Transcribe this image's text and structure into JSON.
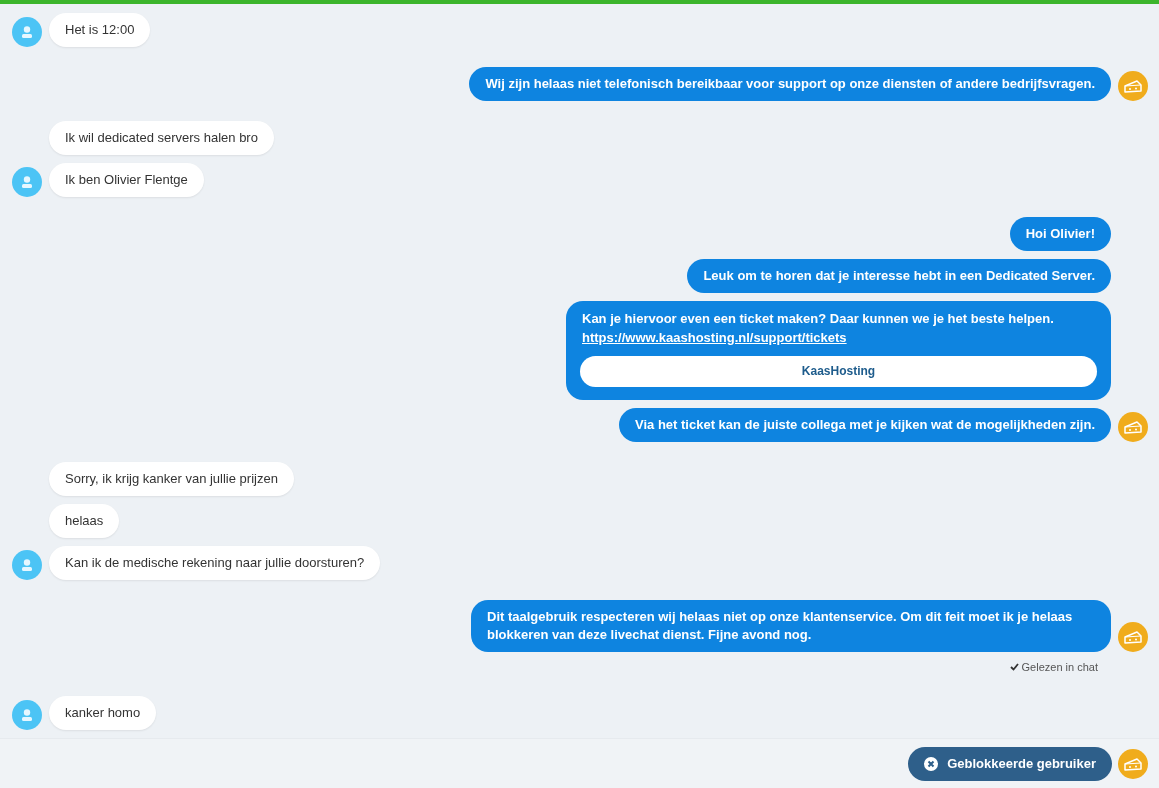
{
  "groups": [
    {
      "kind": "visitor",
      "messages": [
        {
          "kind": "text",
          "text": "Het is 12:00"
        }
      ]
    },
    {
      "kind": "agent",
      "messages": [
        {
          "kind": "text",
          "text": "Wij zijn helaas niet telefonisch bereikbaar voor support op onze diensten of andere bedrijfsvragen."
        }
      ]
    },
    {
      "kind": "visitor",
      "messages": [
        {
          "kind": "text",
          "text": "Ik wil dedicated servers halen bro"
        },
        {
          "kind": "text",
          "text": "Ik ben Olivier Flentge"
        }
      ]
    },
    {
      "kind": "agent",
      "messages": [
        {
          "kind": "text",
          "text": "Hoi Olivier!"
        },
        {
          "kind": "text",
          "text": "Leuk om te horen dat je interesse hebt in een Dedicated Server."
        },
        {
          "kind": "card",
          "text": "Kan je hiervoor even een ticket maken? Daar kunnen we je het beste helpen.",
          "link": "https://www.kaashosting.nl/support/tickets",
          "button": "KaasHosting"
        },
        {
          "kind": "text",
          "text": "Via het ticket kan de juiste collega met je kijken wat de mogelijkheden zijn."
        }
      ]
    },
    {
      "kind": "visitor",
      "messages": [
        {
          "kind": "text",
          "text": "Sorry, ik krijg kanker van jullie prijzen"
        },
        {
          "kind": "text",
          "text": "helaas"
        },
        {
          "kind": "text",
          "text": "Kan ik de medische rekening naar jullie doorsturen?"
        }
      ]
    },
    {
      "kind": "agent",
      "messages": [
        {
          "kind": "text",
          "text": "Dit taalgebruik respecteren wij helaas niet op onze klantenservice. Om dit feit moet ik je helaas blokkeren van deze livechat dienst. Fijne avond nog."
        }
      ],
      "receipt": "Gelezen in chat"
    },
    {
      "kind": "visitor",
      "messages": [
        {
          "kind": "text",
          "text": "kanker homo"
        }
      ]
    }
  ],
  "footer": {
    "blocked_label": "Geblokkeerde gebruiker"
  }
}
